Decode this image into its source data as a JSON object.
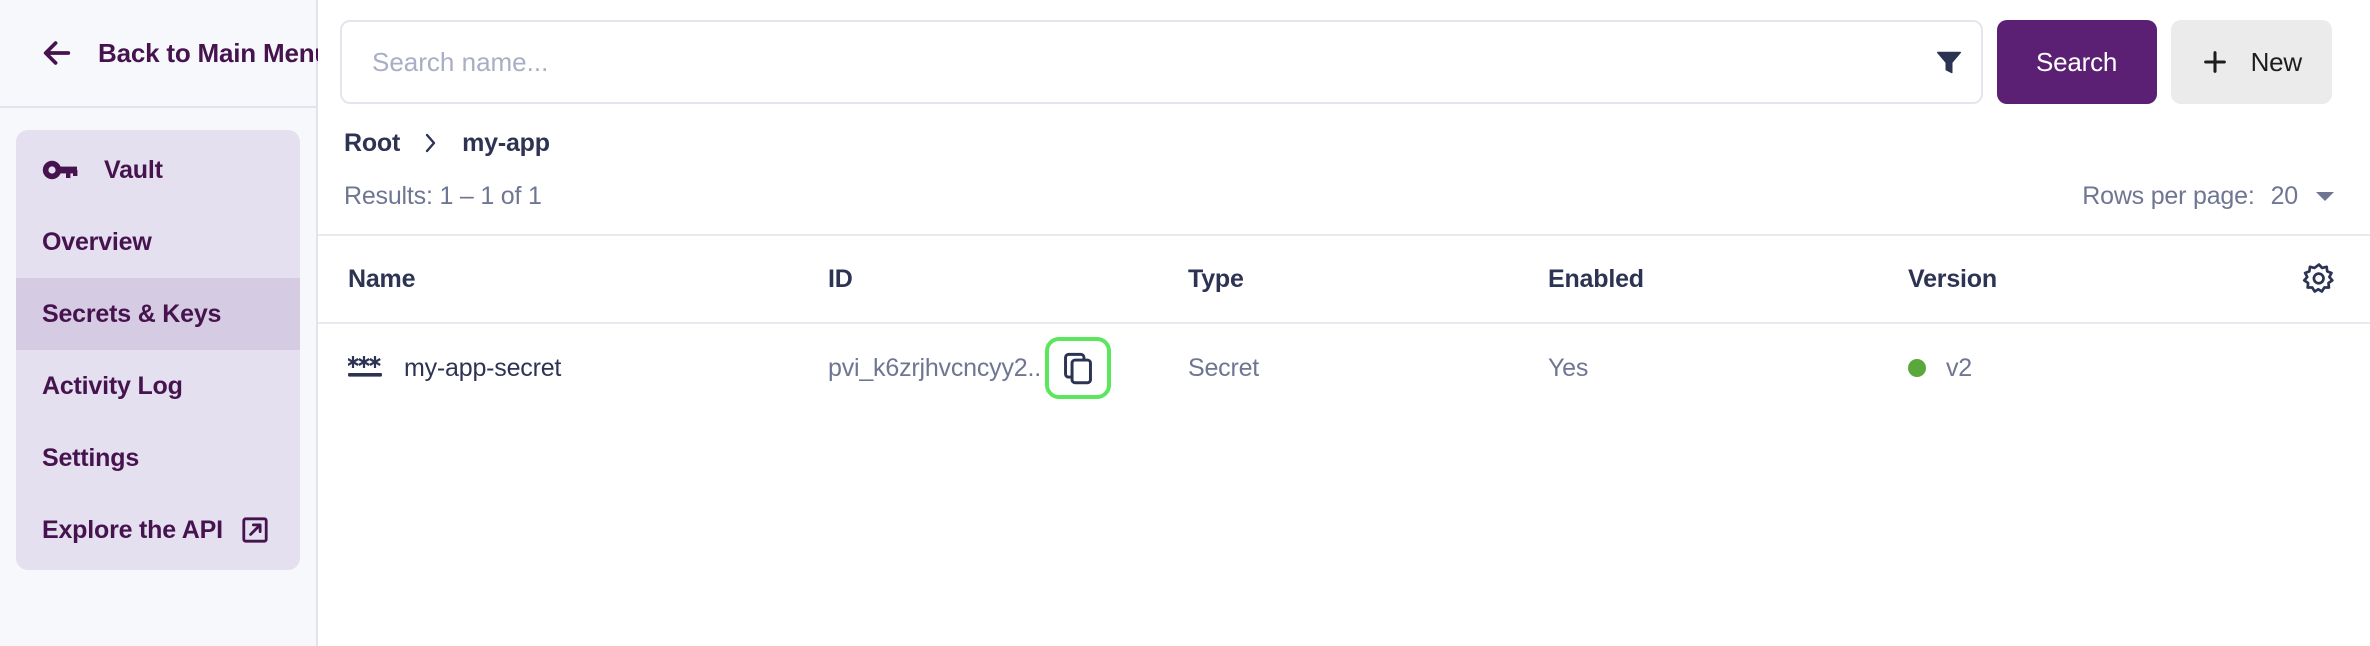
{
  "sidebar": {
    "back": {
      "label": "Back to Main Menu",
      "icon": "arrow-left-icon"
    },
    "items": [
      {
        "label": "Vault",
        "icon": "key-icon",
        "active": false
      },
      {
        "label": "Overview",
        "icon": null,
        "active": false
      },
      {
        "label": "Secrets & Keys",
        "icon": null,
        "active": true
      },
      {
        "label": "Activity Log",
        "icon": null,
        "active": false
      },
      {
        "label": "Settings",
        "icon": null,
        "active": false
      },
      {
        "label": "Explore the API",
        "icon": "external-link-icon",
        "active": false
      }
    ]
  },
  "toolbar": {
    "search_placeholder": "Search name...",
    "search_value": "",
    "filter_icon": "filter-icon",
    "search_label": "Search",
    "new_label": "New",
    "new_icon": "plus-icon"
  },
  "breadcrumb": {
    "root": "Root",
    "separator": "chevron-right-icon",
    "current": "my-app"
  },
  "results": {
    "text": "Results: 1 – 1 of 1",
    "rows_per_page_label": "Rows per page:",
    "rows_per_page_value": "20",
    "rows_per_page_caret": "chevron-down-icon"
  },
  "table": {
    "columns": [
      "Name",
      "ID",
      "Type",
      "Enabled",
      "Version"
    ],
    "settings_icon": "gear-icon",
    "rows": [
      {
        "name": "my-app-secret",
        "name_icon": "secret-asterisks-icon",
        "id": "pvi_k6zrjhvcncyy2..",
        "copy_icon": "copy-icon",
        "type": "Secret",
        "enabled": "Yes",
        "version": "v2",
        "version_status_color": "#5aa83c"
      }
    ]
  },
  "colors": {
    "brand_purple": "#5b2073",
    "sidebar_panel": "#e4e0ef",
    "sidebar_active": "#d5cbe3",
    "text_dark": "#2d3353",
    "text_muted": "#6f7692",
    "highlight_outline": "#5ce65c",
    "page_bg": "#f7f8fc"
  }
}
